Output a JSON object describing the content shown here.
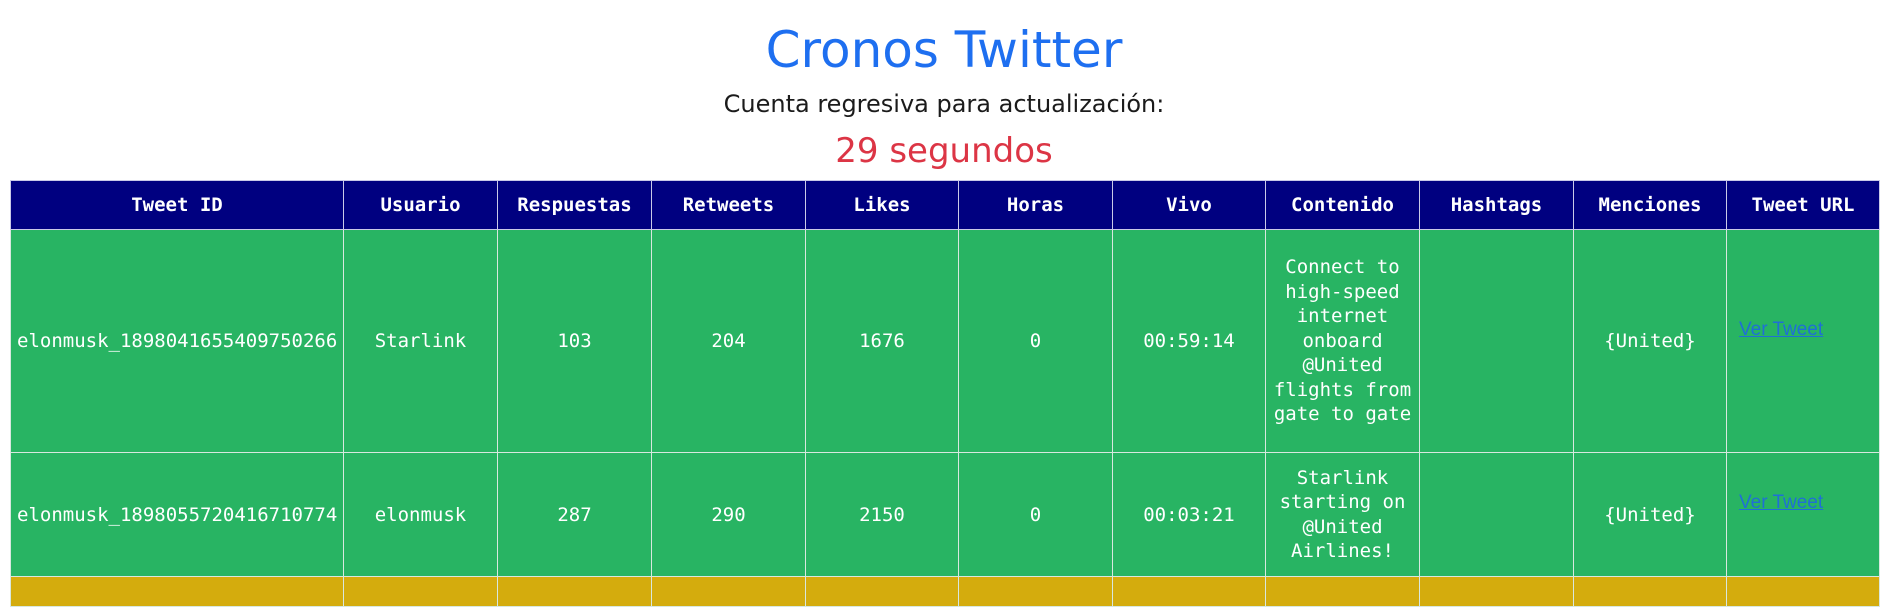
{
  "header": {
    "title": "Cronos Twitter",
    "countdown_label": "Cuenta regresiva para actualización:",
    "countdown_value": "29 segundos"
  },
  "colors": {
    "title": "#1e6ff0",
    "countdown": "#dc3545",
    "table_header": "#000080",
    "row_green": "#28b463",
    "row_yellow": "#d4ac0d",
    "link": "#1f6fd6"
  },
  "table": {
    "columns": [
      "Tweet ID",
      "Usuario",
      "Respuestas",
      "Retweets",
      "Likes",
      "Horas",
      "Vivo",
      "Contenido",
      "Hashtags",
      "Menciones",
      "Tweet URL"
    ],
    "rows": [
      {
        "tweet_id": "elonmusk_1898041655409750266",
        "usuario": "Starlink",
        "respuestas": "103",
        "retweets": "204",
        "likes": "1676",
        "horas": "0",
        "vivo": "00:59:14",
        "contenido": "Connect to high-speed internet onboard @United flights from gate to gate",
        "hashtags": "",
        "menciones": "{United}",
        "link_label": "Ver Tweet",
        "row_color": "green"
      },
      {
        "tweet_id": "elonmusk_1898055720416710774",
        "usuario": "elonmusk",
        "respuestas": "287",
        "retweets": "290",
        "likes": "2150",
        "horas": "0",
        "vivo": "00:03:21",
        "contenido": "Starlink starting on @United Airlines!",
        "hashtags": "",
        "menciones": "{United}",
        "link_label": "Ver Tweet",
        "row_color": "green"
      }
    ]
  }
}
